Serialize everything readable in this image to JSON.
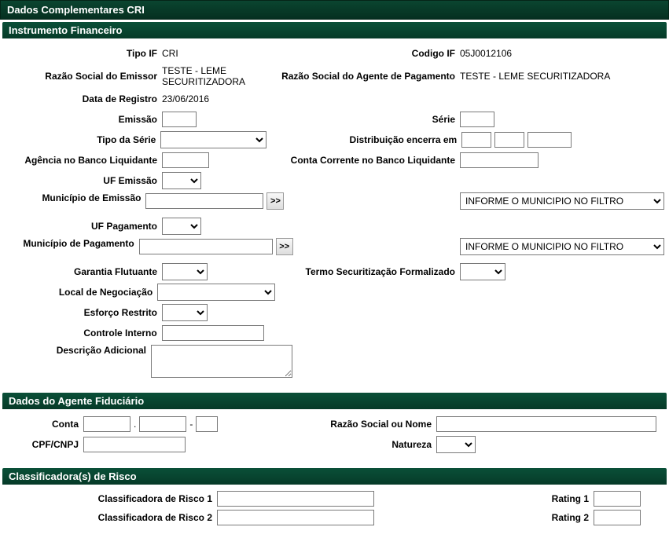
{
  "headers": {
    "main": "Dados Complementares CRI",
    "sub1": "Instrumento Financeiro",
    "sub2": "Dados do Agente Fiduciário",
    "sub3": "Classificadora(s) de Risco"
  },
  "instrumento": {
    "tipo_if_label": "Tipo IF",
    "tipo_if_value": "CRI",
    "codigo_if_label": "Codigo IF",
    "codigo_if_value": "05J0012106",
    "razao_emissor_label": "Razão Social do Emissor",
    "razao_emissor_value": "TESTE - LEME SECURITIZADORA",
    "razao_agente_label": "Razão Social do Agente de Pagamento",
    "razao_agente_value": "TESTE - LEME SECURITIZADORA",
    "data_registro_label": "Data de Registro",
    "data_registro_value": "23/06/2016",
    "emissao_label": "Emissão",
    "serie_label": "Série",
    "tipo_serie_label": "Tipo da Série",
    "distrib_label": "Distribuição encerra em",
    "agencia_label": "Agência no Banco Liquidante",
    "conta_corrente_label": "Conta Corrente no Banco Liquidante",
    "uf_emissao_label": "UF Emissão",
    "municipio_emissao_label": "Município de Emissão",
    "municipio_filtro1": "INFORME O MUNICIPIO NO FILTRO",
    "uf_pagamento_label": "UF Pagamento",
    "municipio_pagamento_label": "Município de Pagamento",
    "municipio_filtro2": "INFORME O MUNICIPIO NO FILTRO",
    "garantia_label": "Garantia Flutuante",
    "termo_label": "Termo Securitização Formalizado",
    "local_neg_label": "Local de Negociação",
    "esforco_label": "Esforço Restrito",
    "controle_label": "Controle Interno",
    "descricao_label": "Descrição Adicional",
    "btn_next": ">>"
  },
  "agente": {
    "conta_label": "Conta",
    "razao_label": "Razão Social ou Nome",
    "cpf_label": "CPF/CNPJ",
    "natureza_label": "Natureza"
  },
  "classificadora": {
    "cr1_label": "Classificadora de Risco 1",
    "r1_label": "Rating 1",
    "cr2_label": "Classificadora de Risco 2",
    "r2_label": "Rating 2"
  }
}
